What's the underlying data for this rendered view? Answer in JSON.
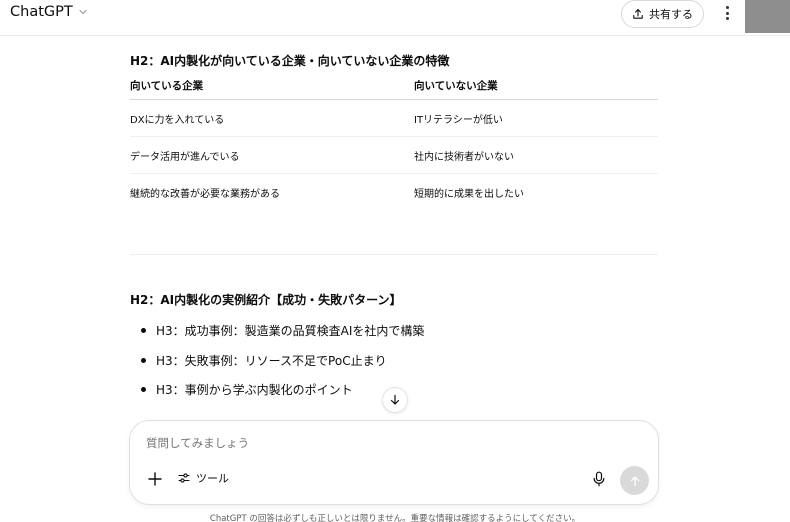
{
  "header": {
    "model_name": "ChatGPT",
    "share_label": "共有する"
  },
  "content": {
    "section1_title": "H2：AI内製化が向いている企業・向いていない企業の特徴",
    "table": {
      "headers": [
        "向いている企業",
        "向いていない企業"
      ],
      "rows": [
        [
          "DXに力を入れている",
          "ITリテラシーが低い"
        ],
        [
          "データ活用が進んでいる",
          "社内に技術者がいない"
        ],
        [
          "継続的な改善が必要な業務がある",
          "短期的に成果を出したい"
        ]
      ]
    },
    "section2_title": "H2：AI内製化の実例紹介【成功・失敗パターン】",
    "bullets": [
      "H3：成功事例：製造業の品質検査AIを社内で構築",
      "H3：失敗事例：リソース不足でPoC止まり",
      "H3：事例から学ぶ内製化のポイント"
    ]
  },
  "composer": {
    "placeholder": "質問してみましょう",
    "tools_label": "ツール"
  },
  "footer": {
    "disclaimer": "ChatGPT の回答は必ずしも正しいとは限りません。重要な情報は確認するようにしてください。"
  },
  "icons": {
    "model_chevron": "chevron-down-icon",
    "share": "share-upload-icon",
    "more": "more-vertical-icon",
    "scroll_down": "arrow-down-icon",
    "plus": "plus-icon",
    "tools": "sliders-icon",
    "mic": "microphone-icon",
    "send": "arrow-up-icon"
  },
  "colors": {
    "text": "#0d0d0d",
    "muted": "#8f8f8f",
    "border": "#e0e0e0",
    "send_disabled": "#d9d9d9",
    "avatar": "#8e8e8e"
  }
}
